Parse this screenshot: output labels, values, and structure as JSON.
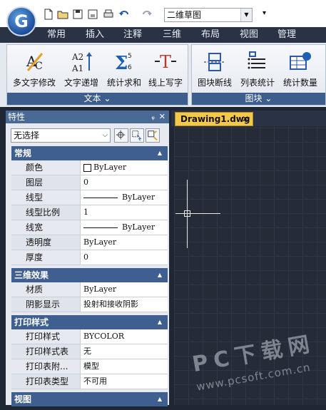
{
  "qab": {
    "app_letter": "G",
    "workspace": "二维草图",
    "more": "▾"
  },
  "tabs": [
    "常用",
    "插入",
    "注释",
    "三维",
    "布局",
    "视图",
    "管理"
  ],
  "ribbon": {
    "text_panel": {
      "title": "文本",
      "caret": "⌄",
      "buttons": [
        "多文字修改",
        "文字递增",
        "统计求和",
        "线上写字"
      ]
    },
    "block_panel": {
      "title": "图块",
      "caret": "⌄",
      "buttons": [
        "图块断线",
        "列表统计",
        "统计数量"
      ]
    }
  },
  "properties": {
    "title": "特性",
    "pin": "ᵩ",
    "close": "✕",
    "selection": "无选择",
    "sections": [
      {
        "title": "常规",
        "rows": [
          {
            "name": "颜色",
            "value": "ByLayer",
            "swatch": true
          },
          {
            "name": "图层",
            "value": "0"
          },
          {
            "name": "线型",
            "value": "ByLayer",
            "line": true
          },
          {
            "name": "线型比例",
            "value": "1"
          },
          {
            "name": "线宽",
            "value": "ByLayer",
            "line": true
          },
          {
            "name": "透明度",
            "value": "ByLayer"
          },
          {
            "name": "厚度",
            "value": "0"
          }
        ]
      },
      {
        "title": "三维效果",
        "rows": [
          {
            "name": "材质",
            "value": "ByLayer"
          },
          {
            "name": "阴影显示",
            "value": "投射和接收阴影"
          }
        ]
      },
      {
        "title": "打印样式",
        "rows": [
          {
            "name": "打印样式",
            "value": "BYCOLOR"
          },
          {
            "name": "打印样式表",
            "value": "无"
          },
          {
            "name": "打印表附...",
            "value": "模型"
          },
          {
            "name": "打印表类型",
            "value": "不可用"
          }
        ]
      },
      {
        "title": "视图",
        "rows": []
      }
    ]
  },
  "document": {
    "tab": "Drawing1.dwg",
    "close": "✕"
  },
  "watermark": {
    "main": "PC下载网",
    "sub": "www.pcsoft.com.cn"
  },
  "colors": {
    "ribbon_title": "#3d5e8c",
    "section": "#3e5f8f",
    "doc_tab": "#f4c84a",
    "canvas": "#252c38"
  }
}
